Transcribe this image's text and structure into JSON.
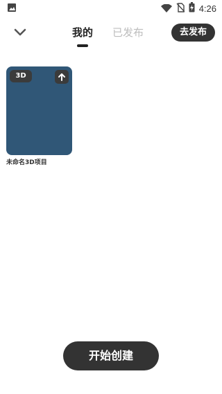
{
  "status_bar": {
    "time": "4:26",
    "icons": [
      "image-icon",
      "wifi-icon",
      "no-sim-icon",
      "battery-charging-icon"
    ]
  },
  "header": {
    "back_icon": "chevron-down-icon",
    "tabs": [
      {
        "label": "我的",
        "active": true
      },
      {
        "label": "已发布",
        "active": false
      }
    ],
    "publish_label": "去发布"
  },
  "projects": [
    {
      "title": "未命名3D项目",
      "badge": "3D",
      "thumbnail_color": "#305777",
      "action_icon": "arrow-up-icon"
    }
  ],
  "footer": {
    "create_label": "开始创建"
  }
}
